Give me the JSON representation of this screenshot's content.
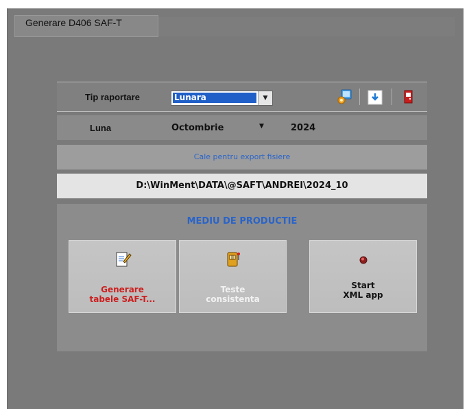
{
  "window": {
    "title": "Generare D406 SAF-T"
  },
  "report_type": {
    "label": "Tip raportare",
    "value": "Lunara"
  },
  "toolbar": {
    "icons": [
      "settings-monitor-icon",
      "download-icon",
      "exit-door-icon"
    ]
  },
  "month_row": {
    "label": "Luna",
    "month": "Octombrie",
    "year": "2024"
  },
  "export": {
    "caption": "Cale pentru export fisiere",
    "path": "D:\\WinMent\\DATA\\@SAFT\\ANDREI\\2024_10"
  },
  "production": {
    "title": "MEDIU DE PRODUCTIE",
    "tiles": [
      {
        "line1": "Generare",
        "line2": "tabele SAF-T...",
        "icon": "edit-document-icon",
        "color": "#cc1f1f"
      },
      {
        "line1": "Teste",
        "line2": "consistenta",
        "icon": "slot-machine-icon",
        "color": "#f2f2f2"
      },
      {
        "line1": "Start",
        "line2": "XML app",
        "icon": "red-status-light-icon",
        "color": "#111111"
      }
    ]
  },
  "colors": {
    "accent_blue": "#2a64c8",
    "selection_blue": "#1f5fc7",
    "alert_red": "#cc1f1f"
  }
}
